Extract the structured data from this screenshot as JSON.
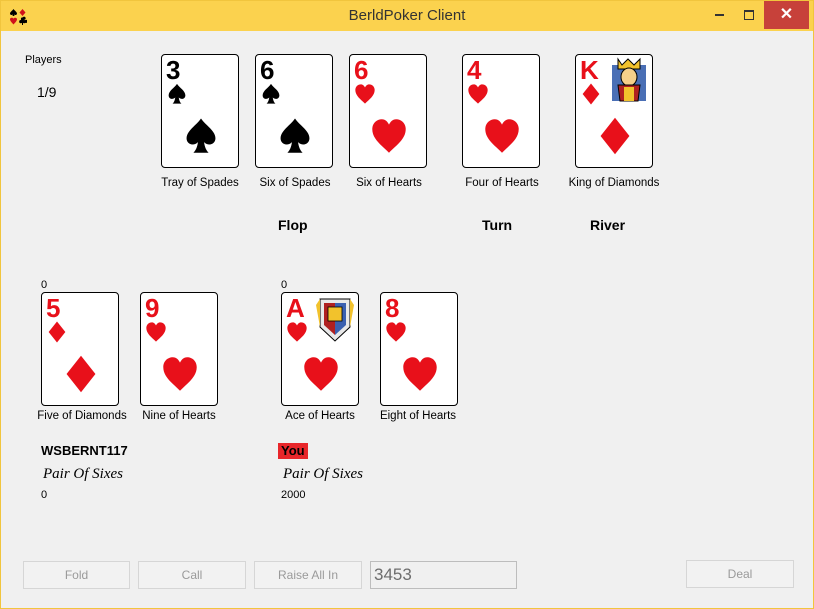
{
  "window": {
    "title": "BerldPoker Client",
    "close_glyph": "✕"
  },
  "players_label": "Players",
  "players_count": "1/9",
  "board": {
    "cards": [
      {
        "rank": "3",
        "suit": "spades",
        "caption": "Tray of Spades"
      },
      {
        "rank": "6",
        "suit": "spades",
        "caption": "Six of Spades"
      },
      {
        "rank": "6",
        "suit": "hearts",
        "caption": "Six of Hearts"
      },
      {
        "rank": "4",
        "suit": "hearts",
        "caption": "Four of Hearts"
      },
      {
        "rank": "K",
        "suit": "diamonds",
        "caption": "King of Diamonds"
      }
    ],
    "flop_label": "Flop",
    "turn_label": "Turn",
    "river_label": "River"
  },
  "players": [
    {
      "bet": "0",
      "name": "WSBERNT117",
      "hand": "Pair Of Sixes",
      "chips": "0",
      "cards": [
        {
          "rank": "5",
          "suit": "diamonds",
          "caption": "Five of Diamonds"
        },
        {
          "rank": "9",
          "suit": "hearts",
          "caption": "Nine of Hearts"
        }
      ]
    },
    {
      "bet": "0",
      "name": "You",
      "hand": "Pair Of Sixes",
      "chips": "2000",
      "cards": [
        {
          "rank": "A",
          "suit": "hearts",
          "caption": "Ace of Hearts"
        },
        {
          "rank": "8",
          "suit": "hearts",
          "caption": "Eight of Hearts"
        }
      ]
    }
  ],
  "controls": {
    "fold": "Fold",
    "call": "Call",
    "raise": "Raise All In",
    "bet_amount": "3453",
    "deal": "Deal"
  },
  "colors": {
    "titlebar": "#fbd24e",
    "close": "#c7413a",
    "red_suit": "#e8101a",
    "black_suit": "#000000",
    "you_badge": "#e8262a"
  }
}
